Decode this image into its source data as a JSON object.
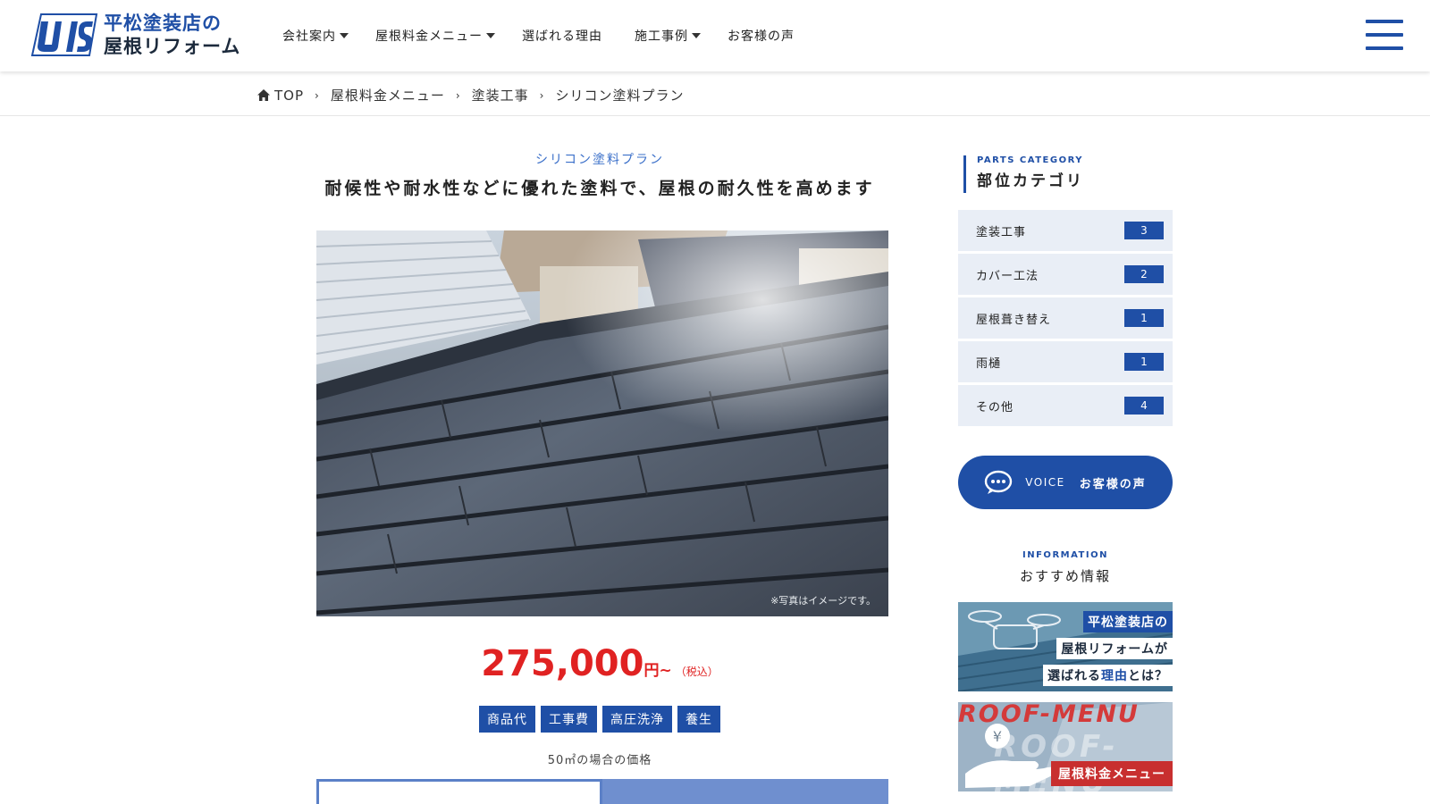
{
  "brand": {
    "name_line1": "平松塗装店の",
    "name_line2": "屋根リフォーム",
    "accent_color": "#1f4fa6",
    "price_color": "#e02222"
  },
  "nav": {
    "items": [
      {
        "label": "会社案内",
        "dropdown": true
      },
      {
        "label": "屋根料金メニュー",
        "dropdown": true
      },
      {
        "label": "選ばれる理由",
        "dropdown": false
      },
      {
        "label": "施工事例",
        "dropdown": true
      },
      {
        "label": "お客様の声",
        "dropdown": false
      }
    ],
    "menu_icon": "hamburger-icon"
  },
  "breadcrumb": {
    "items": [
      "TOP",
      "屋根料金メニュー",
      "塗装工事",
      "シリコン塗料プラン"
    ]
  },
  "main": {
    "subtitle": "シリコン塗料プラン",
    "heading": "耐候性や耐水性などに優れた塗料で、屋根の耐久性を高めます",
    "image_note": "※写真はイメージです。",
    "price": {
      "amount": "275,000",
      "unit": "円~",
      "tax": "（税込）"
    },
    "tags": [
      "商品代",
      "工事費",
      "高圧洗浄",
      "養生"
    ],
    "area_note": "50㎡の場合の価格"
  },
  "sidebar": {
    "category_en": "PARTS CATEGORY",
    "category_ja": "部位カテゴリ",
    "categories": [
      {
        "label": "塗装工事",
        "count": "3"
      },
      {
        "label": "カバー工法",
        "count": "2"
      },
      {
        "label": "屋根葺き替え",
        "count": "1"
      },
      {
        "label": "雨樋",
        "count": "1"
      },
      {
        "label": "その他",
        "count": "4"
      }
    ],
    "voice": {
      "en": "VOICE",
      "ja": "お客様の声"
    },
    "info_en": "INFORMATION",
    "info_ja": "おすすめ情報",
    "banner1": {
      "line1": "平松塗装店の",
      "line2": "屋根リフォームが",
      "line3_pre": "選ばれる",
      "line3_em": "理由",
      "line3_post": "とは？"
    },
    "banner2": {
      "title": "ROOF-MENU",
      "label": "屋根料金メニュー"
    }
  }
}
